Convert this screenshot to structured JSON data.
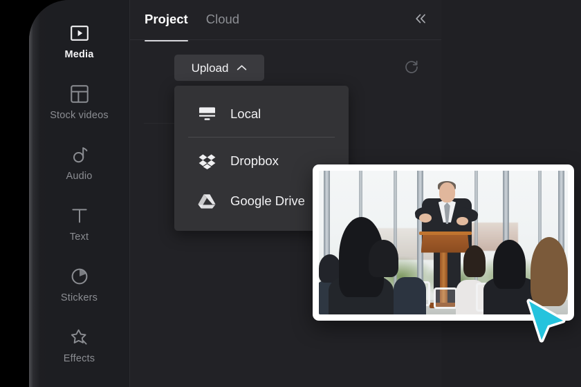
{
  "window": {
    "background_color": "#000000",
    "app_background": "#202024",
    "panel_background": "#222226",
    "sidebar_background": "#1d1e22",
    "menu_background": "#333336",
    "accent_cursor_color": "#25c3dd"
  },
  "sidebar": {
    "items": [
      {
        "label": "Media",
        "icon": "media-play-rect-icon",
        "active": true
      },
      {
        "label": "Stock videos",
        "icon": "layout-grid-icon",
        "active": false
      },
      {
        "label": "Audio",
        "icon": "music-note-icon",
        "active": false
      },
      {
        "label": "Text",
        "icon": "text-t-icon",
        "active": false
      },
      {
        "label": "Stickers",
        "icon": "sticker-circle-icon",
        "active": false
      },
      {
        "label": "Effects",
        "icon": "magic-star-icon",
        "active": false
      }
    ]
  },
  "panel": {
    "tabs": [
      {
        "label": "Project",
        "active": true
      },
      {
        "label": "Cloud",
        "active": false
      }
    ],
    "collapse_icon": "chevron-double-left-icon",
    "toolbar": {
      "upload_label": "Upload",
      "upload_chevron_icon": "chevron-up-icon",
      "refresh_icon": "refresh-icon"
    },
    "upload_menu": {
      "items": [
        {
          "label": "Local",
          "icon": "desktop-monitor-icon"
        },
        {
          "label": "Dropbox",
          "icon": "dropbox-icon"
        },
        {
          "label": "Google Drive",
          "icon": "google-drive-icon"
        }
      ]
    }
  },
  "preview": {
    "alt": "Businessman speaking at a wooden podium to a seated audience in a bright glass-walled conference room",
    "card_background": "#ffffff"
  },
  "pointer": {
    "icon": "arrow-cursor-icon",
    "fill_color": "#25c3dd",
    "outline_color": "#ffffff"
  }
}
